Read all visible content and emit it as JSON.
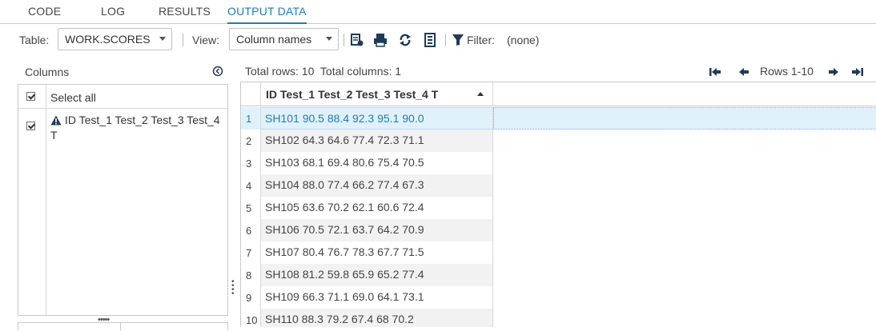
{
  "tabs": [
    {
      "label": "CODE",
      "active": false
    },
    {
      "label": "LOG",
      "active": false
    },
    {
      "label": "RESULTS",
      "active": false
    },
    {
      "label": "OUTPUT DATA",
      "active": true
    }
  ],
  "toolbar": {
    "table_label": "Table:",
    "table_value": "WORK.SCORES",
    "view_label": "View:",
    "view_value": "Column names",
    "filter_label": "Filter:",
    "filter_value": "(none)",
    "icons": [
      "add-column-icon",
      "print-icon",
      "refresh-icon",
      "properties-icon",
      "filter-icon"
    ]
  },
  "columns_panel": {
    "title": "Columns",
    "select_all_label": "Select all",
    "select_all_checked": true,
    "items": [
      {
        "label": "ID Test_1 Test_2 Test_3 Test_4 T",
        "checked": true,
        "icon": "warning-icon"
      }
    ]
  },
  "grid": {
    "total_rows": "Total rows: 10",
    "total_columns": "Total columns: 1",
    "rows_range": "Rows 1-10",
    "column_header": "ID Test_1 Test_2 Test_3 Test_4 T",
    "rows": [
      {
        "num": "1",
        "value": "SH101 90.5 88.4 92.3 95.1 90.0"
      },
      {
        "num": "2",
        "value": "SH102 64.3 64.6 77.4 72.3 71.1"
      },
      {
        "num": "3",
        "value": "SH103 68.1 69.4 80.6 75.4 70.5"
      },
      {
        "num": "4",
        "value": "SH104 88.0 77.4 66.2 77.4 67.3"
      },
      {
        "num": "5",
        "value": "SH105 63.6 70.2 62.1 60.6 72.4"
      },
      {
        "num": "6",
        "value": "SH106 70.5 72.1 63.7 64.2 70.9"
      },
      {
        "num": "7",
        "value": "SH107 80.4 76.7 78.3 67.7 71.5"
      },
      {
        "num": "8",
        "value": "SH108 81.2 59.8 65.9 65.2 77.4"
      },
      {
        "num": "9",
        "value": "SH109 66.3 71.1 69.0 64.1 73.1"
      },
      {
        "num": "10",
        "value": "SH110 88.3 79.2 67.4 68 70.2"
      }
    ],
    "selected_row": "1"
  },
  "colors": {
    "accent": "#1d7db8",
    "selected_bg": "#e1f1fb",
    "alt_row": "#f2f2f2"
  }
}
